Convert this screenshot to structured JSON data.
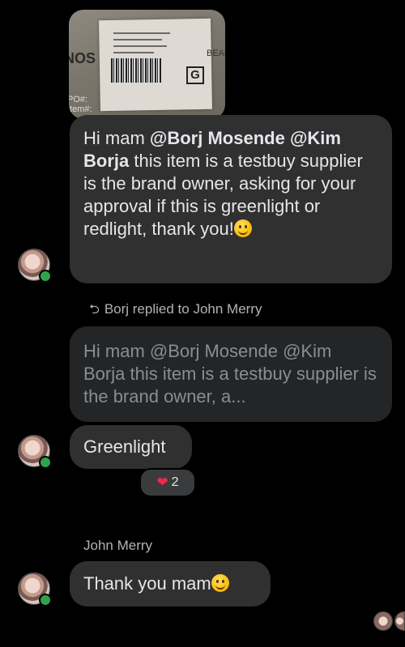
{
  "photo": {
    "left_text": "NOS",
    "right_text": "BEAC",
    "po_text": "PO#:",
    "item_text": "Item#:",
    "g_letter": "G"
  },
  "message1": {
    "prefix": "Hi mam ",
    "mention1": "@Borj Mosende",
    "space": " ",
    "mention2": "@Kim Borja",
    "body": " this item is a testbuy supplier is the brand owner, asking for your approval if this is greenlight or redlight, thank you!",
    "emoji": "slightly-smiling-face-emoji"
  },
  "reply": {
    "context": "Borj replied to John Merry",
    "quoted_text": "Hi mam @Borj Mosende @Kim Borja this item is a testbuy supplier is the brand owner, a...",
    "message": "Greenlight",
    "reaction_count": "2",
    "reaction_icon": "heart-icon"
  },
  "message3": {
    "sender": "John Merry",
    "text": "Thank you mam",
    "emoji": "slightly-smiling-face-emoji"
  },
  "colors": {
    "background": "#000000",
    "bubble": "#303030",
    "quoted_bubble": "#242526",
    "online_dot": "#31a24c",
    "heart": "#f02849"
  }
}
